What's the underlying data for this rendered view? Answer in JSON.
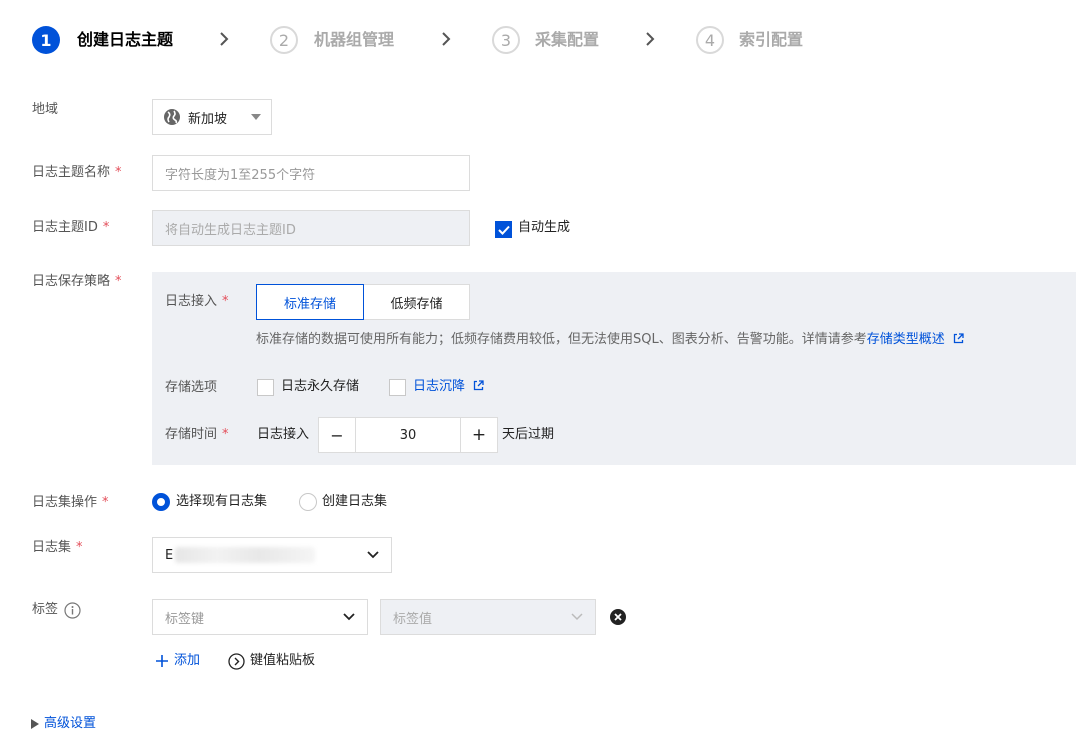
{
  "steps": [
    {
      "num": "1",
      "label": "创建日志主题"
    },
    {
      "num": "2",
      "label": "机器组管理"
    },
    {
      "num": "3",
      "label": "采集配置"
    },
    {
      "num": "4",
      "label": "索引配置"
    }
  ],
  "region": {
    "label": "地域",
    "value": "新加坡"
  },
  "topic_name": {
    "label": "日志主题名称",
    "placeholder": "字符长度为1至255个字符"
  },
  "topic_id": {
    "label": "日志主题ID",
    "placeholder": "将自动生成日志主题ID",
    "auto_label": "自动生成"
  },
  "retention": {
    "label": "日志保存策略",
    "access_label": "日志接入",
    "options": [
      "标准存储",
      "低频存储"
    ],
    "desc": "标准存储的数据可使用所有能力；低频存储费用较低，但无法使用SQL、图表分析、告警功能。详情请参考",
    "desc_link": "存储类型概述",
    "storage_opts_label": "存储选项",
    "permanent_label": "日志永久存储",
    "sink_label": "日志沉降",
    "time_label": "存储时间",
    "time_prefix": "日志接入",
    "minus": "−",
    "days": "30",
    "plus": "+",
    "time_suffix": "天后过期"
  },
  "logset_op": {
    "label": "日志集操作",
    "options": [
      "选择现有日志集",
      "创建日志集"
    ]
  },
  "logset": {
    "label": "日志集",
    "value_prefix": "E"
  },
  "tags": {
    "label": "标签",
    "key_placeholder": "标签键",
    "value_placeholder": "标签值",
    "add_label": "添加",
    "clipboard_label": "键值粘贴板"
  },
  "advanced": {
    "label": "高级设置"
  },
  "required_mark": "*",
  "colors": {
    "primary": "#0052d9",
    "required": "#e34d59"
  }
}
